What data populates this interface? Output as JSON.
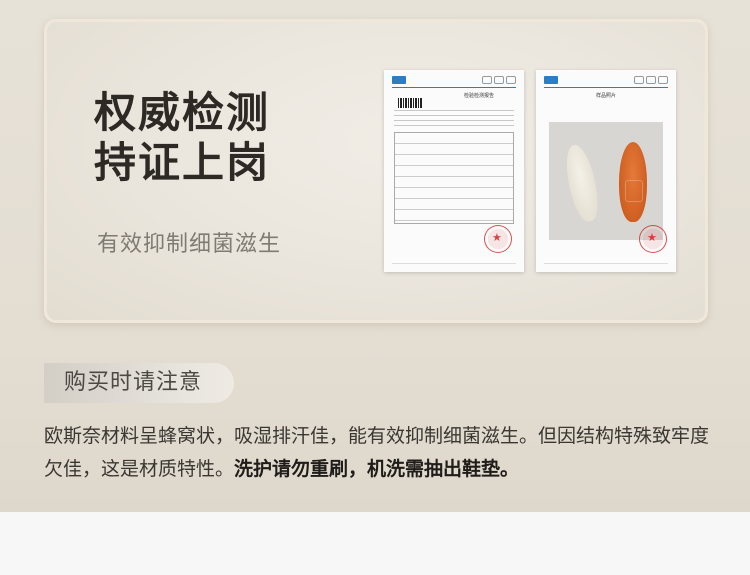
{
  "hero": {
    "title_line1": "权威检测",
    "title_line2": "持证上岗",
    "subtitle": "有效抑制细菌滋生"
  },
  "documents": {
    "report1_title": "检验检测报告",
    "report2_title": "样品照片"
  },
  "notice": {
    "tag": "购买时请注意",
    "text_normal": "欧斯奈材料呈蜂窝状，吸湿排汗佳，能有效抑制细菌滋生。但因结构特殊致牢度欠佳，这是材质特性。",
    "text_bold": "洗护请勿重刷，机洗需抽出鞋垫。"
  },
  "colors": {
    "accent_orange": "#cf5f22",
    "stamp_red": "#d22828",
    "logo_blue": "#2a7ec4"
  }
}
